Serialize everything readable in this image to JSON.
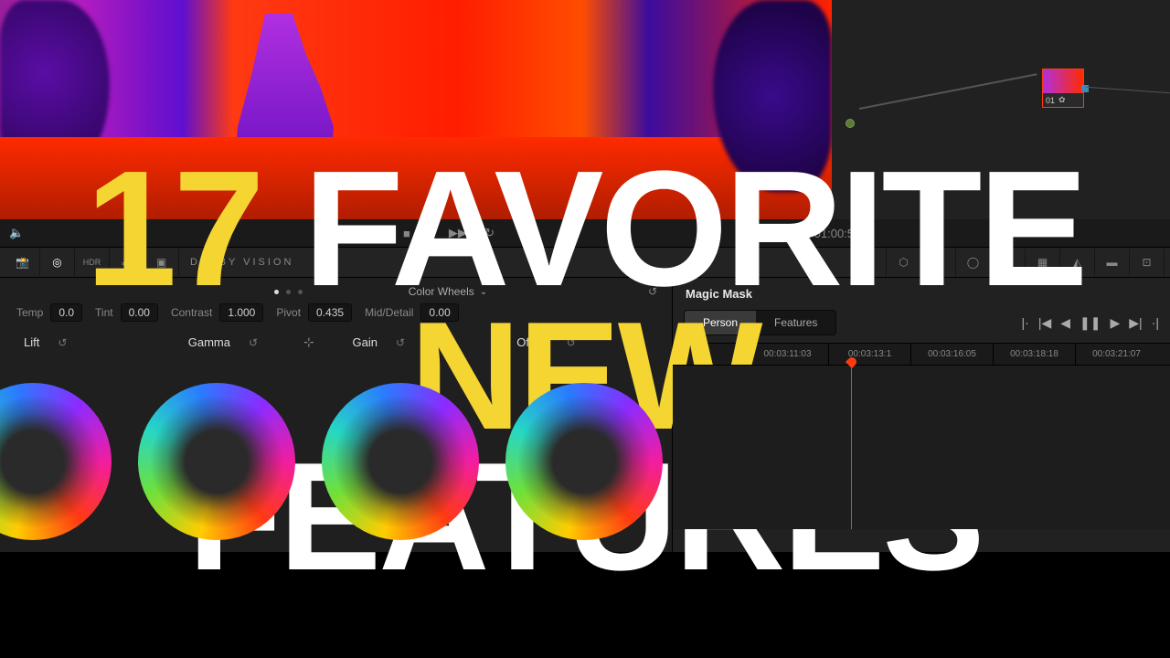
{
  "overlay": {
    "number": "17",
    "word1": "FAVORITE",
    "word2": "NEW",
    "word3": "FEATURES"
  },
  "node": {
    "id": "01"
  },
  "transport": {
    "timecode": "01:00:5"
  },
  "toolbar": {
    "left": [
      {
        "name": "camera-raw-icon",
        "active": false
      },
      {
        "name": "color-wheel-icon",
        "active": true
      },
      {
        "name": "hdr-icon",
        "active": false,
        "label": "HDR"
      },
      {
        "name": "rgb-mixer-icon",
        "active": false
      },
      {
        "name": "motion-effects-icon",
        "active": false
      }
    ],
    "dolby_label": "DOLBY VISION",
    "right": [
      {
        "name": "curves-icon"
      },
      {
        "name": "color-warper-icon"
      },
      {
        "name": "qualifier-icon"
      },
      {
        "name": "window-icon"
      },
      {
        "name": "tracker-icon"
      },
      {
        "name": "magic-mask-icon"
      },
      {
        "name": "blur-icon"
      },
      {
        "name": "key-icon"
      },
      {
        "name": "sizing-icon"
      }
    ]
  },
  "color_wheels": {
    "title": "Color Wheels",
    "adjustments": {
      "temp": {
        "label": "Temp",
        "value": "0.0"
      },
      "tint": {
        "label": "Tint",
        "value": "0.00"
      },
      "contrast": {
        "label": "Contrast",
        "value": "1.000"
      },
      "pivot": {
        "label": "Pivot",
        "value": "0.435"
      },
      "mid_detail": {
        "label": "Mid/Detail",
        "value": "0.00"
      }
    },
    "wheels": {
      "lift": {
        "label": "Lift"
      },
      "gamma": {
        "label": "Gamma"
      },
      "gain": {
        "label": "Gain"
      },
      "offset": {
        "label": "Offset"
      }
    }
  },
  "magic_mask": {
    "title": "Magic Mask",
    "tabs": {
      "person": "Person",
      "features": "Features",
      "selected": "person"
    },
    "timeline_marks": [
      "00:03:11:03",
      "00:03:13:1",
      "00:03:16:05",
      "00:03:18:18",
      "00:03:21:07"
    ]
  }
}
